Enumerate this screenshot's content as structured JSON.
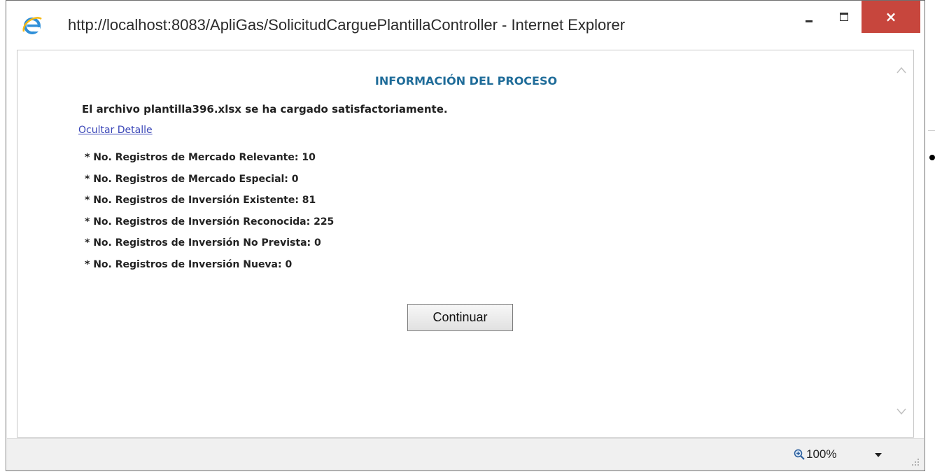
{
  "window": {
    "title": "http://localhost:8083/ApliGas/SolicitudCarguePlantillaController - Internet Explorer",
    "close_glyph": "×"
  },
  "dialog": {
    "heading": "INFORMACIÓN DEL PROCESO",
    "message": "El archivo plantilla396.xlsx se ha cargado satisfactoriamente.",
    "detail_link": "Ocultar Detalle",
    "stats": [
      "* No. Registros de Mercado Relevante: 10",
      "* No. Registros de Mercado Especial: 0",
      "* No. Registros de Inversión Existente: 81",
      "* No. Registros de Inversión Reconocida: 225",
      "* No. Registros de Inversión No Prevista: 0",
      "* No. Registros de Inversión Nueva: 0"
    ],
    "continue_label": "Continuar"
  },
  "statusbar": {
    "zoom": "100%"
  },
  "colors": {
    "heading": "#1f6c99",
    "link": "#3b47b8",
    "close_button": "#c7463d"
  }
}
